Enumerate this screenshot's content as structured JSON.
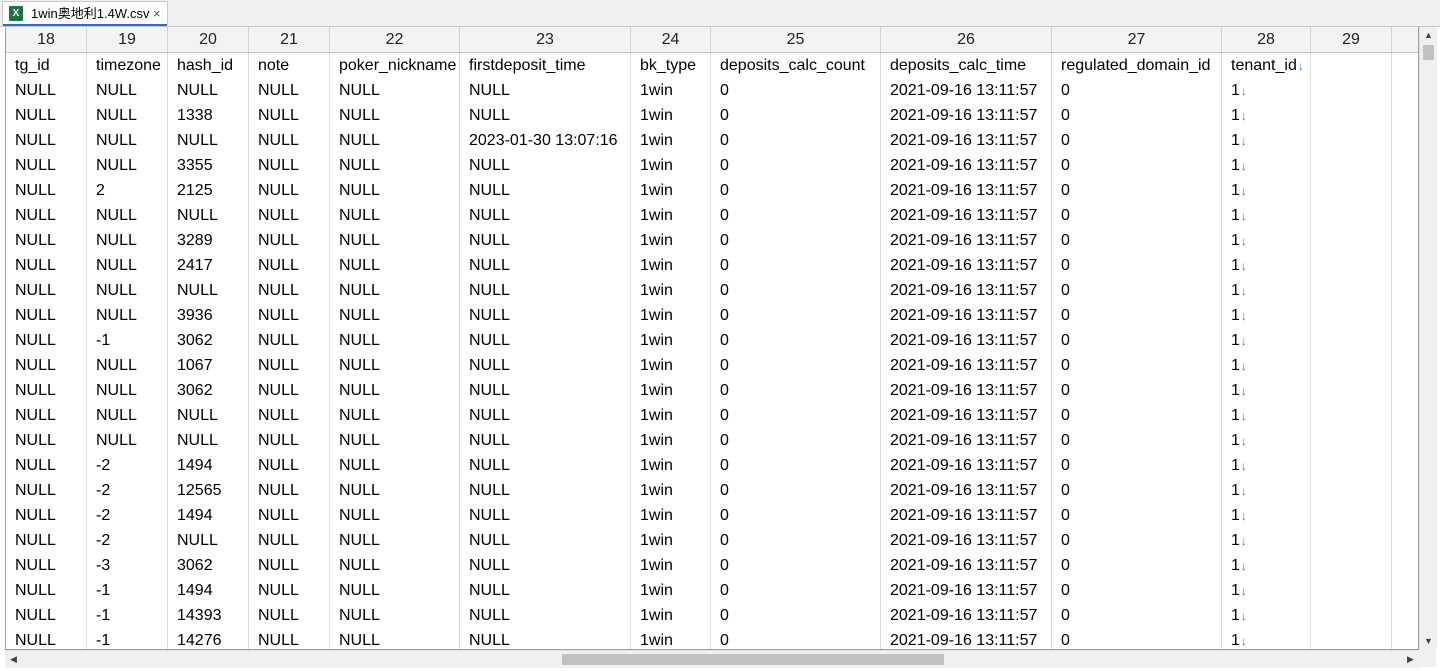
{
  "tab": {
    "title": "1win奥地利1.4W.csv",
    "close": "×",
    "icon": "excel-icon"
  },
  "columns": [
    {
      "num": "18",
      "name": "tg_id"
    },
    {
      "num": "19",
      "name": "timezone"
    },
    {
      "num": "20",
      "name": "hash_id"
    },
    {
      "num": "21",
      "name": "note"
    },
    {
      "num": "22",
      "name": "poker_nickname"
    },
    {
      "num": "23",
      "name": "firstdeposit_time"
    },
    {
      "num": "24",
      "name": "bk_type"
    },
    {
      "num": "25",
      "name": "deposits_calc_count"
    },
    {
      "num": "26",
      "name": "deposits_calc_time"
    },
    {
      "num": "27",
      "name": "regulated_domain_id"
    },
    {
      "num": "28",
      "name": "tenant_id"
    },
    {
      "num": "29",
      "name": ""
    }
  ],
  "newline_mark": "↓",
  "rows": [
    [
      "NULL",
      "NULL",
      "NULL",
      "NULL",
      "NULL",
      "NULL",
      "1win",
      "0",
      "2021-09-16 13:11:57",
      "0",
      "1",
      ""
    ],
    [
      "NULL",
      "NULL",
      "1338",
      "NULL",
      "NULL",
      "NULL",
      "1win",
      "0",
      "2021-09-16 13:11:57",
      "0",
      "1",
      ""
    ],
    [
      "NULL",
      "NULL",
      "NULL",
      "NULL",
      "NULL",
      "2023-01-30 13:07:16",
      "1win",
      "0",
      "2021-09-16 13:11:57",
      "0",
      "1",
      ""
    ],
    [
      "NULL",
      "NULL",
      "3355",
      "NULL",
      "NULL",
      "NULL",
      "1win",
      "0",
      "2021-09-16 13:11:57",
      "0",
      "1",
      ""
    ],
    [
      "NULL",
      "2",
      "2125",
      "NULL",
      "NULL",
      "NULL",
      "1win",
      "0",
      "2021-09-16 13:11:57",
      "0",
      "1",
      ""
    ],
    [
      "NULL",
      "NULL",
      "NULL",
      "NULL",
      "NULL",
      "NULL",
      "1win",
      "0",
      "2021-09-16 13:11:57",
      "0",
      "1",
      ""
    ],
    [
      "NULL",
      "NULL",
      "3289",
      "NULL",
      "NULL",
      "NULL",
      "1win",
      "0",
      "2021-09-16 13:11:57",
      "0",
      "1",
      ""
    ],
    [
      "NULL",
      "NULL",
      "2417",
      "NULL",
      "NULL",
      "NULL",
      "1win",
      "0",
      "2021-09-16 13:11:57",
      "0",
      "1",
      ""
    ],
    [
      "NULL",
      "NULL",
      "NULL",
      "NULL",
      "NULL",
      "NULL",
      "1win",
      "0",
      "2021-09-16 13:11:57",
      "0",
      "1",
      ""
    ],
    [
      "NULL",
      "NULL",
      "3936",
      "NULL",
      "NULL",
      "NULL",
      "1win",
      "0",
      "2021-09-16 13:11:57",
      "0",
      "1",
      ""
    ],
    [
      "NULL",
      "-1",
      "3062",
      "NULL",
      "NULL",
      "NULL",
      "1win",
      "0",
      "2021-09-16 13:11:57",
      "0",
      "1",
      ""
    ],
    [
      "NULL",
      "NULL",
      "1067",
      "NULL",
      "NULL",
      "NULL",
      "1win",
      "0",
      "2021-09-16 13:11:57",
      "0",
      "1",
      ""
    ],
    [
      "NULL",
      "NULL",
      "3062",
      "NULL",
      "NULL",
      "NULL",
      "1win",
      "0",
      "2021-09-16 13:11:57",
      "0",
      "1",
      ""
    ],
    [
      "NULL",
      "NULL",
      "NULL",
      "NULL",
      "NULL",
      "NULL",
      "1win",
      "0",
      "2021-09-16 13:11:57",
      "0",
      "1",
      ""
    ],
    [
      "NULL",
      "NULL",
      "NULL",
      "NULL",
      "NULL",
      "NULL",
      "1win",
      "0",
      "2021-09-16 13:11:57",
      "0",
      "1",
      ""
    ],
    [
      "NULL",
      "-2",
      "1494",
      "NULL",
      "NULL",
      "NULL",
      "1win",
      "0",
      "2021-09-16 13:11:57",
      "0",
      "1",
      ""
    ],
    [
      "NULL",
      "-2",
      "12565",
      "NULL",
      "NULL",
      "NULL",
      "1win",
      "0",
      "2021-09-16 13:11:57",
      "0",
      "1",
      ""
    ],
    [
      "NULL",
      "-2",
      "1494",
      "NULL",
      "NULL",
      "NULL",
      "1win",
      "0",
      "2021-09-16 13:11:57",
      "0",
      "1",
      ""
    ],
    [
      "NULL",
      "-2",
      "NULL",
      "NULL",
      "NULL",
      "NULL",
      "1win",
      "0",
      "2021-09-16 13:11:57",
      "0",
      "1",
      ""
    ],
    [
      "NULL",
      "-3",
      "3062",
      "NULL",
      "NULL",
      "NULL",
      "1win",
      "0",
      "2021-09-16 13:11:57",
      "0",
      "1",
      ""
    ],
    [
      "NULL",
      "-1",
      "1494",
      "NULL",
      "NULL",
      "NULL",
      "1win",
      "0",
      "2021-09-16 13:11:57",
      "0",
      "1",
      ""
    ],
    [
      "NULL",
      "-1",
      "14393",
      "NULL",
      "NULL",
      "NULL",
      "1win",
      "0",
      "2021-09-16 13:11:57",
      "0",
      "1",
      ""
    ],
    [
      "NULL",
      "-1",
      "14276",
      "NULL",
      "NULL",
      "NULL",
      "1win",
      "0",
      "2021-09-16 13:11:57",
      "0",
      "1",
      ""
    ]
  ],
  "scroll": {
    "up": "▲",
    "down": "▼",
    "left": "◀",
    "right": "▶"
  }
}
